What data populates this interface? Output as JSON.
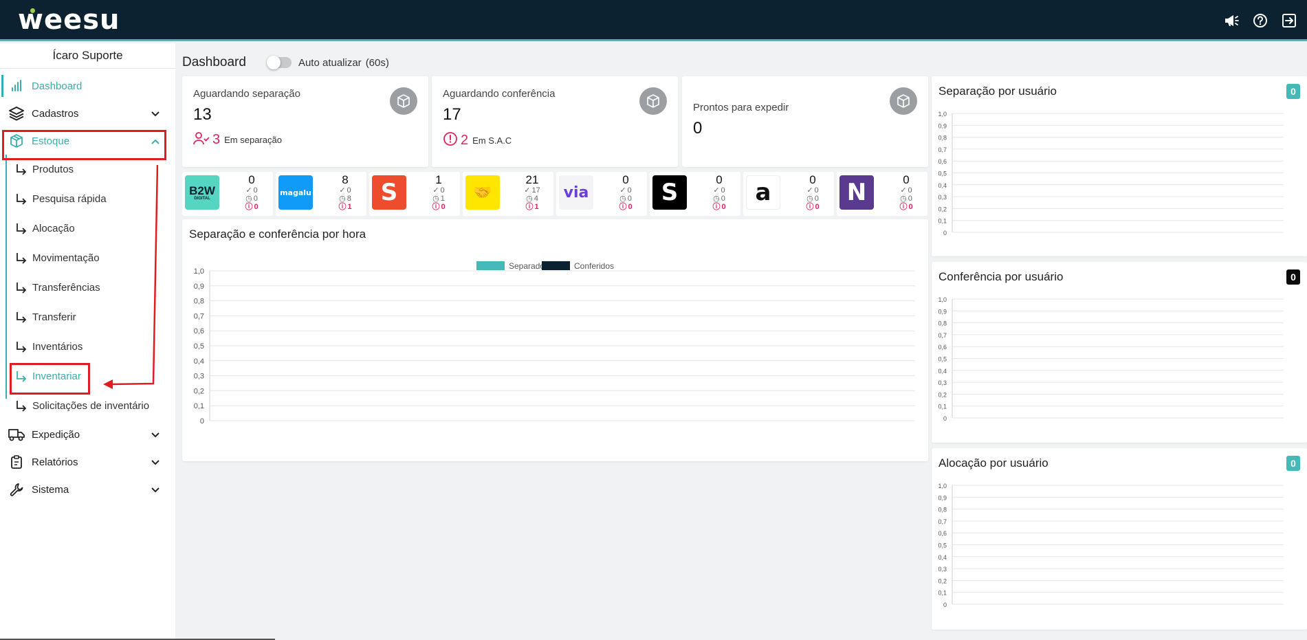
{
  "brand": {
    "logo": "weesu",
    "dot_color": "#9bd14a"
  },
  "topbar": {
    "icons": [
      "megaphone-icon",
      "help-icon",
      "logout-icon"
    ]
  },
  "sidebar": {
    "user": "Ícaro Suporte",
    "items": [
      {
        "label": "Dashboard",
        "icon": "bar-chart-icon",
        "active": true
      },
      {
        "label": "Cadastros",
        "icon": "layers-icon"
      },
      {
        "label": "Estoque",
        "icon": "box-icon",
        "expanded": true
      }
    ],
    "estoque_sub": [
      {
        "label": "Produtos"
      },
      {
        "label": "Pesquisa rápida"
      },
      {
        "label": "Alocação"
      },
      {
        "label": "Movimentação"
      },
      {
        "label": "Transferências"
      },
      {
        "label": "Transferir"
      },
      {
        "label": "Inventários"
      },
      {
        "label": "Inventariar",
        "active": true
      },
      {
        "label": "Solicitações de inventário"
      }
    ],
    "bottom_items": [
      {
        "label": "Expedição",
        "icon": "truck-icon"
      },
      {
        "label": "Relatórios",
        "icon": "clipboard-icon"
      },
      {
        "label": "Sistema",
        "icon": "wrench-icon"
      }
    ]
  },
  "dashboard": {
    "title": "Dashboard",
    "auto_update": {
      "label": "Auto atualizar",
      "interval": "(60s)",
      "on": false
    }
  },
  "stats": [
    {
      "label": "Aguardando separação",
      "value": "13",
      "sub_value": "3",
      "sub_label": "Em separação",
      "sub_icon": "user-check-icon"
    },
    {
      "label": "Aguardando conferência",
      "value": "17",
      "sub_value": "2",
      "sub_label": "Em S.A.C",
      "sub_icon": "alert-circle-icon"
    },
    {
      "label": "Prontos para expedir",
      "value": "0"
    }
  ],
  "marketplaces": [
    {
      "name": "b2w-logo",
      "logo_text": "B2W",
      "logo_sub": "DIGITAL",
      "total": "0",
      "checked": "0",
      "pending": "0",
      "alerts": "0",
      "bg": "#55d6c2",
      "fg": "#0c2230"
    },
    {
      "name": "magalu-logo",
      "logo_text": "magalu",
      "total": "8",
      "checked": "0",
      "pending": "8",
      "alerts": "1",
      "bg": "#0f9bf7",
      "fg": "#ffffff"
    },
    {
      "name": "shopee-logo",
      "logo_text": "S",
      "total": "1",
      "checked": "0",
      "pending": "1",
      "alerts": "0",
      "bg": "#ee4d2d",
      "fg": "#ffffff"
    },
    {
      "name": "mercado-livre-logo",
      "logo_text": "🤝",
      "total": "21",
      "checked": "17",
      "pending": "4",
      "alerts": "1",
      "bg": "#ffe600",
      "fg": "#2d3277"
    },
    {
      "name": "via-logo",
      "logo_text": "via",
      "total": "0",
      "checked": "0",
      "pending": "0",
      "alerts": "0",
      "bg": "#f4f4f6",
      "fg": "#6a3fd6"
    },
    {
      "name": "shein-logo",
      "logo_text": "S",
      "total": "0",
      "checked": "0",
      "pending": "0",
      "alerts": "0",
      "bg": "#000000",
      "fg": "#ffffff"
    },
    {
      "name": "amazon-logo",
      "logo_text": "a",
      "total": "0",
      "checked": "0",
      "pending": "0",
      "alerts": "0",
      "bg": "#ffffff",
      "fg": "#111111"
    },
    {
      "name": "netshoes-logo",
      "logo_text": "N",
      "total": "0",
      "checked": "0",
      "pending": "0",
      "alerts": "0",
      "bg": "#5a3a8f",
      "fg": "#ffffff"
    }
  ],
  "chart_data": [
    {
      "type": "line",
      "title": "Separação e conferência por hora",
      "series": [
        {
          "name": "Separados",
          "color": "#45b8b8",
          "values": []
        },
        {
          "name": "Conferidos",
          "color": "#0c2230",
          "values": []
        }
      ],
      "ylim": [
        0,
        1
      ],
      "yticks": [
        "0",
        "0,1",
        "0,2",
        "0,3",
        "0,4",
        "0,5",
        "0,6",
        "0,7",
        "0,8",
        "0,9",
        "1,0"
      ],
      "legend": "top-center",
      "grid": true
    },
    {
      "type": "bar",
      "title": "Separação por usuário",
      "badge": "0",
      "badge_color": "#45b8b8",
      "series": [],
      "ylim": [
        0,
        1
      ],
      "yticks": [
        "0",
        "0,1",
        "0,2",
        "0,3",
        "0,4",
        "0,5",
        "0,6",
        "0,7",
        "0,8",
        "0,9",
        "1,0"
      ],
      "grid": true
    },
    {
      "type": "bar",
      "title": "Conferência por usuário",
      "badge": "0",
      "badge_color": "#0c0c0c",
      "series": [],
      "ylim": [
        0,
        1
      ],
      "yticks": [
        "0",
        "0,1",
        "0,2",
        "0,3",
        "0,4",
        "0,5",
        "0,6",
        "0,7",
        "0,8",
        "0,9",
        "1,0"
      ],
      "grid": true
    },
    {
      "type": "bar",
      "title": "Alocação por usuário",
      "badge": "0",
      "badge_color": "#45b8b8",
      "series": [],
      "ylim": [
        0,
        1
      ],
      "yticks": [
        "0",
        "0,1",
        "0,2",
        "0,3",
        "0,4",
        "0,5",
        "0,6",
        "0,7",
        "0,8",
        "0,9",
        "1,0"
      ],
      "grid": true
    }
  ],
  "colors": {
    "accent": "#3aaeae",
    "alert": "#e0245e",
    "header": "#0c2230",
    "highlight": "#e01c23"
  }
}
